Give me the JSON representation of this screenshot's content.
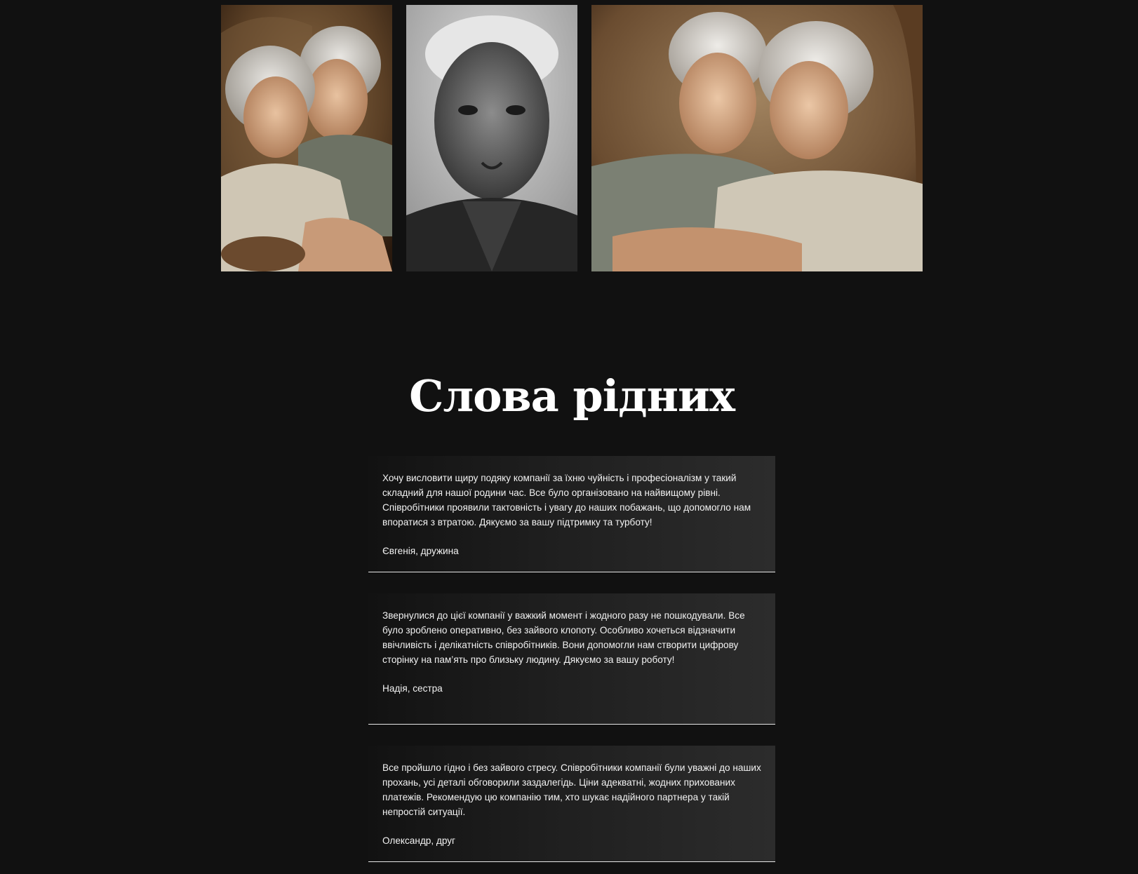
{
  "gallery": {
    "photos": [
      {
        "icon": "elderly-couple-photo"
      },
      {
        "icon": "elderly-man-bw-portrait-photo"
      },
      {
        "icon": "elderly-couple-photo"
      }
    ]
  },
  "testimonials": {
    "title": "Слова рідних",
    "items": [
      {
        "text": "Хочу висловити щиру подяку компанії за їхню чуйність і професіоналізм у такий складний для нашої родини час. Все було організовано на найвищому рівні. Співробітники проявили тактовність і увагу до наших побажань, що допомогло нам впоратися з втратою. Дякуємо за вашу підтримку та турботу!",
        "author": "Євгенія, дружина"
      },
      {
        "text": "Звернулися до цієї компанії у важкий момент і жодного разу не пошкодували. Все було зроблено оперативно, без зайвого клопоту. Особливо хочеться відзначити ввічливість і делікатність співробітників. Вони допомогли нам створити цифрову сторінку на пам’ять про близьку людину. Дякуємо за вашу роботу!",
        "author": "Надія, сестра"
      },
      {
        "text": "Все пройшло гідно і без зайвого стресу. Співробітники компанії були уважні до наших прохань, усі деталі обговорили заздалегідь. Ціни адекватні, жодних прихованих платежів. Рекомендую цю компанію тим, хто шукає надійного партнера у такій непростій ситуації.",
        "author": "Олександр, друг"
      }
    ]
  },
  "colors": {
    "background": "#111111",
    "card_start": "#121212",
    "card_end": "#2c2c2c",
    "divider": "#e6e6e6",
    "text": "#ffffff"
  }
}
